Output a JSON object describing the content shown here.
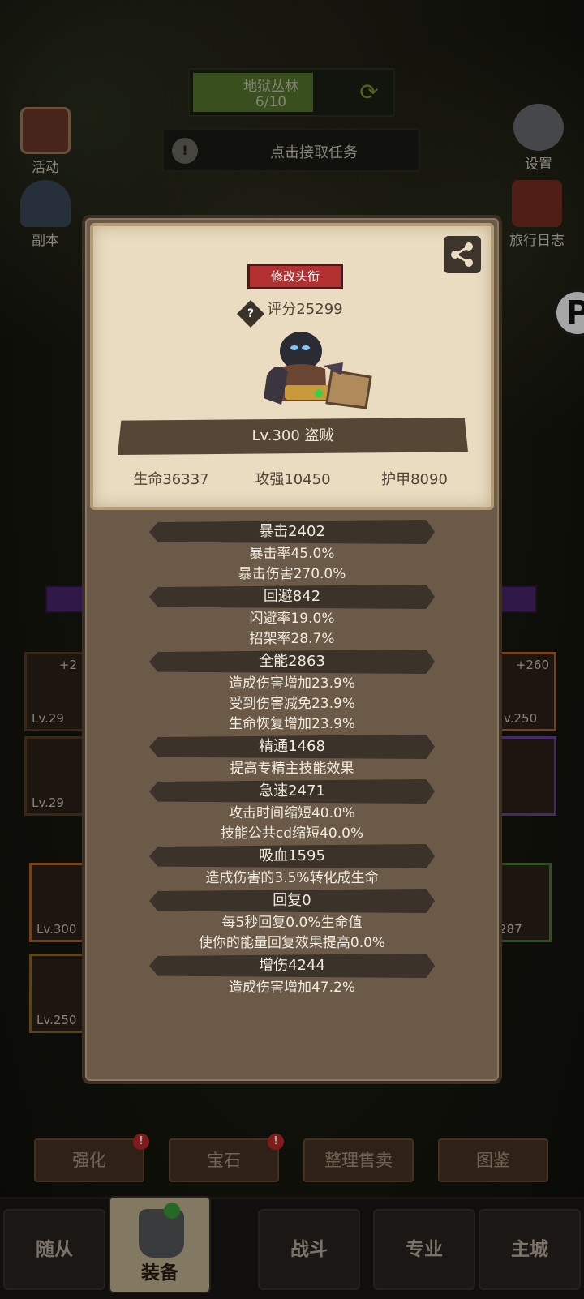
{
  "hud": {
    "stage_name": "地狱丛林",
    "stage_progress": "6/10",
    "task_label": "点击接取任务",
    "activity_label": "活动",
    "dungeon_label": "副本",
    "settings_label": "设置",
    "journal_label": "旅行日志"
  },
  "background_slots": [
    {
      "plus": "+2",
      "level": "Lv.29"
    },
    {
      "plus": "",
      "level": "Lv.29"
    },
    {
      "plus": "+260",
      "level": "v.250"
    },
    {
      "plus": "",
      "level": "Lv.300"
    },
    {
      "plus": "",
      "level": "287"
    },
    {
      "plus": "",
      "level": "Lv.250"
    }
  ],
  "bottom_buttons": [
    "强化",
    "宝石",
    "整理售卖",
    "图鉴"
  ],
  "nav": {
    "items": [
      "随从",
      "装备",
      "战斗",
      "专业",
      "主城"
    ],
    "active": "装备"
  },
  "profile": {
    "title_button": "修改头衔",
    "score_label": "评分25299",
    "level_class": "Lv.300 盗贼",
    "hp": "生命36337",
    "attack": "攻强10450",
    "armor": "护甲8090"
  },
  "attributes": [
    {
      "name": "暴击2402",
      "details": [
        "暴击率45.0%",
        "暴击伤害270.0%"
      ]
    },
    {
      "name": "回避842",
      "details": [
        "闪避率19.0%",
        "招架率28.7%"
      ]
    },
    {
      "name": "全能2863",
      "details": [
        "造成伤害增加23.9%",
        "受到伤害减免23.9%",
        "生命恢复增加23.9%"
      ]
    },
    {
      "name": "精通1468",
      "details": [
        "提高专精主技能效果"
      ]
    },
    {
      "name": "急速2471",
      "details": [
        "攻击时间缩短40.0%",
        "技能公共cd缩短40.0%"
      ]
    },
    {
      "name": "吸血1595",
      "details": [
        "造成伤害的3.5%转化成生命"
      ]
    },
    {
      "name": "回复0",
      "details": [
        "每5秒回复0.0%生命值",
        "使你的能量回复效果提高0.0%"
      ]
    },
    {
      "name": "增伤4244",
      "details": [
        "造成伤害增加47.2%"
      ]
    }
  ]
}
